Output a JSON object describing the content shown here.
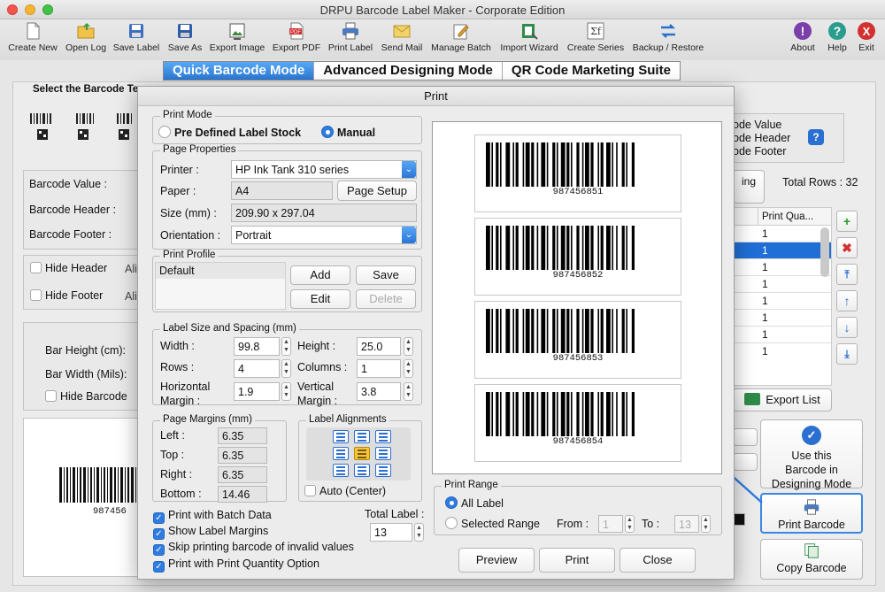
{
  "window": {
    "title": "DRPU Barcode Label Maker - Corporate Edition"
  },
  "toolbar": [
    {
      "label": "Create New",
      "icon": "new-file-icon"
    },
    {
      "label": "Open Log",
      "icon": "open-folder-icon"
    },
    {
      "label": "Save Label",
      "icon": "save-icon"
    },
    {
      "label": "Save As",
      "icon": "save-as-icon"
    },
    {
      "label": "Export Image",
      "icon": "export-image-icon"
    },
    {
      "label": "Export PDF",
      "icon": "export-pdf-icon"
    },
    {
      "label": "Print Label",
      "icon": "printer-icon"
    },
    {
      "label": "Send Mail",
      "icon": "mail-icon"
    },
    {
      "label": "Manage Batch",
      "icon": "batch-icon"
    },
    {
      "label": "Import Wizard",
      "icon": "import-wizard-icon"
    },
    {
      "label": "Create Series",
      "icon": "series-icon"
    },
    {
      "label": "Backup / Restore",
      "icon": "backup-restore-icon"
    },
    {
      "label": "About",
      "icon": "about-icon"
    },
    {
      "label": "Help",
      "icon": "help-icon"
    },
    {
      "label": "Exit",
      "icon": "exit-icon"
    }
  ],
  "modes": [
    "Quick Barcode Mode",
    "Advanced Designing Mode",
    "QR Code Marketing Suite"
  ],
  "background": {
    "select_barcode": "Select the Barcode Te",
    "barcode_value": "Barcode Value :",
    "barcode_header": "Barcode Header :",
    "barcode_footer": "Barcode Footer :",
    "hide_header": "Hide Header",
    "hide_footer": "Hide Footer",
    "ali1": "Ali",
    "ali2": "Ali",
    "bar_height": "Bar Height (cm):",
    "bar_width": "Bar Width (Mils):",
    "hide_barcode": "Hide Barcode",
    "preview_number": "987456",
    "opt_value": "ode Value",
    "opt_header": "ode Header",
    "opt_footer": "ode Footer",
    "tab_fragment": "ing",
    "total_rows": "Total Rows : 32",
    "col_qty": "Print Qua...",
    "rows": [
      "1",
      "1",
      "1",
      "1",
      "1",
      "1",
      "1",
      "1"
    ],
    "export_list": "Export List",
    "use_designing": "Use this Barcode in Designing Mode",
    "print_barcode": "Print Barcode",
    "copy_barcode": "Copy Barcode",
    "colors": {
      "selected_row": "#1f6fd6",
      "accent": "#2e7ce0"
    }
  },
  "dialog": {
    "title": "Print",
    "print_mode": {
      "label": "Print Mode",
      "option1": "Pre Defined Label Stock",
      "option2": "Manual",
      "selected": "Manual"
    },
    "page_properties": {
      "label": "Page Properties",
      "printer_label": "Printer :",
      "printer": "HP Ink Tank 310 series",
      "paper_label": "Paper :",
      "paper": "A4",
      "page_setup": "Page Setup",
      "size_label": "Size (mm) :",
      "size": "209.90 x 297.04",
      "orientation_label": "Orientation :",
      "orientation": "Portrait"
    },
    "print_profile": {
      "label": "Print Profile",
      "item": "Default",
      "add": "Add",
      "save": "Save",
      "edit": "Edit",
      "delete": "Delete"
    },
    "label_size": {
      "label": "Label Size and Spacing (mm)",
      "width_label": "Width :",
      "width": "99.8",
      "height_label": "Height :",
      "height": "25.0",
      "rows_label": "Rows :",
      "rows": "4",
      "columns_label": "Columns :",
      "columns": "1",
      "hmargin_label1": "Horizontal",
      "hmargin_label2": "Margin :",
      "hmargin": "1.9",
      "vmargin_label1": "Vertical",
      "vmargin_label2": "Margin :",
      "vmargin": "3.8"
    },
    "page_margins": {
      "label": "Page Margins (mm)",
      "left_label": "Left :",
      "left": "6.35",
      "top_label": "Top :",
      "top": "6.35",
      "right_label": "Right :",
      "right": "6.35",
      "bottom_label": "Bottom :",
      "bottom": "14.46"
    },
    "alignments": {
      "label": "Label Alignments",
      "auto_center": "Auto (Center)"
    },
    "options": {
      "batch": "Print with Batch Data",
      "margins": "Show Label Margins",
      "skip": "Skip printing barcode of invalid values",
      "quantity": "Print with Print Quantity Option"
    },
    "total_label": {
      "label": "Total Label :",
      "value": "13"
    },
    "print_range": {
      "label": "Print Range",
      "all": "All Label",
      "selected": "Selected Range",
      "from_label": "From :",
      "from": "1",
      "to_label": "To :",
      "to": "13"
    },
    "labels": [
      "987456851",
      "987456852",
      "987456853",
      "987456854"
    ],
    "buttons": {
      "preview": "Preview",
      "print": "Print",
      "close": "Close"
    }
  }
}
